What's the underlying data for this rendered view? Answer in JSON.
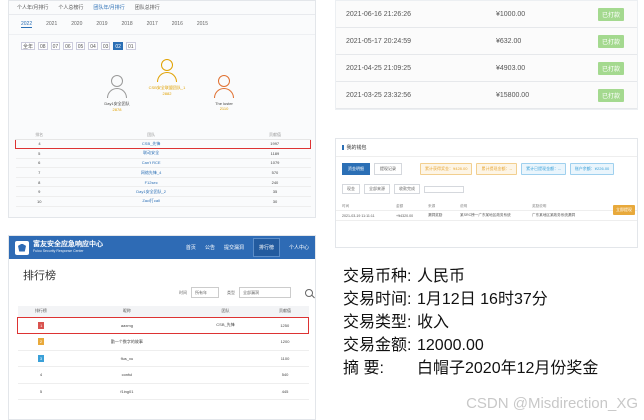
{
  "panel_a": {
    "tabs": [
      "个人年/月排行",
      "个人总榜行",
      "团队年/月排行",
      "团队总排行"
    ],
    "active_tab": 2,
    "years": [
      "2022",
      "2021",
      "2020",
      "2019",
      "2018",
      "2017",
      "2016",
      "2015"
    ],
    "active_year": 0,
    "months_label": "全年",
    "months": [
      "08",
      "07",
      "06",
      "05",
      "04",
      "03",
      "02",
      "01"
    ],
    "active_month": 6,
    "podium": [
      {
        "name": "Day1安全团队",
        "score": "2878"
      },
      {
        "name": "CSB安全联盟团队_1",
        "score": "2882"
      },
      {
        "name": "The luster",
        "score": "2110"
      }
    ],
    "table_headers": [
      "排名",
      "团队",
      "贡献值"
    ],
    "rows": [
      {
        "rank": "4",
        "team": "CSB_先锋",
        "score": "1997"
      },
      {
        "rank": "5",
        "team": "联动安全",
        "score": "1189"
      },
      {
        "rank": "6",
        "team": "Can't RCE",
        "score": "1079"
      },
      {
        "rank": "7",
        "team": "网络先锋_4",
        "score": "570"
      },
      {
        "rank": "8",
        "team": "F12sec",
        "score": "240"
      },
      {
        "rank": "9",
        "team": "Day1安全团队_2",
        "score": "35"
      },
      {
        "rank": "10",
        "team": "Zacl打call",
        "score": "30"
      }
    ],
    "highlight_row": 0
  },
  "panel_b": {
    "rows": [
      {
        "date": "2021-06-16 21:26:26",
        "amount": "¥1000.00",
        "status": "已打款"
      },
      {
        "date": "2021-05-17 20:24:59",
        "amount": "¥632.00",
        "status": "已打款"
      },
      {
        "date": "2021-04-25 21:09:25",
        "amount": "¥4903.00",
        "status": "已打款"
      },
      {
        "date": "2021-03-25 23:32:56",
        "amount": "¥15800.00",
        "status": "已打款"
      }
    ]
  },
  "panel_c": {
    "title": "我的钱包",
    "btn_primary": "资金明细",
    "btn_secondary": "提现记录",
    "chips": [
      {
        "text": "累计获得奖金：¥428.00",
        "color": "#e8a93b"
      },
      {
        "text": "累计提现金额：--",
        "color": "#e8a93b"
      },
      {
        "text": "累计已提现金额：--",
        "color": "#3aa0d8"
      },
      {
        "text": "账户余额：¥226.00",
        "color": "#3aa0d8"
      }
    ],
    "filter_a": "现金",
    "filter_b": "全部来源",
    "filter_c": "收款完成",
    "columns": [
      "时间",
      "金额",
      "来源",
      "说明",
      "奖励说明"
    ],
    "row": [
      "2021-03-19 11:11:11",
      "+¥4320.00",
      "漏洞奖励",
      "某SRC榜一广东某地区政务系统",
      "广东某地区某政务系统漏洞"
    ],
    "wallet_btn": "立即提现"
  },
  "panel_d": {
    "brand": "富友安全应急响应中心",
    "brand_en": "Fuiou Security Response Center",
    "nav": [
      "首页",
      "公告",
      "提交漏洞",
      "排行榜",
      "个人中心"
    ],
    "active_nav": 3,
    "title": "排行榜",
    "time_label": "时间",
    "time_value": "所有年",
    "type_label": "类型",
    "type_value": "全部漏洞",
    "headers": [
      "排行榜",
      "昵称",
      "团队",
      "贡献值"
    ],
    "rows": [
      {
        "rank": "1",
        "nick": "aaxmg",
        "team": "CSB_先锋",
        "score": "1250"
      },
      {
        "rank": "2",
        "nick": "勤一个数字的故事",
        "team": "",
        "score": "1200"
      },
      {
        "rank": "3",
        "nick": "flus_xu",
        "team": "",
        "score": "1100"
      },
      {
        "rank": "4",
        "nick": "conful",
        "team": "",
        "score": "540"
      },
      {
        "rank": "5",
        "nick": "f1ing01",
        "team": "",
        "score": "445"
      }
    ],
    "medal_colors": [
      "#d9534f",
      "#e8a93b",
      "#3aa0d8"
    ],
    "highlight_row": 0
  },
  "panel_e": {
    "lines": [
      {
        "label": "交易币种:",
        "value": "人民币"
      },
      {
        "label": "交易时间:",
        "value": "1月12日 16时37分"
      },
      {
        "label": "交易类型:",
        "value": "收入"
      },
      {
        "label": "交易金额:",
        "value": "12000.00"
      },
      {
        "label": "摘      要:",
        "value": "白帽子2020年12月份奖金"
      }
    ],
    "watermark": "CSDN @Misdirection_XG"
  }
}
